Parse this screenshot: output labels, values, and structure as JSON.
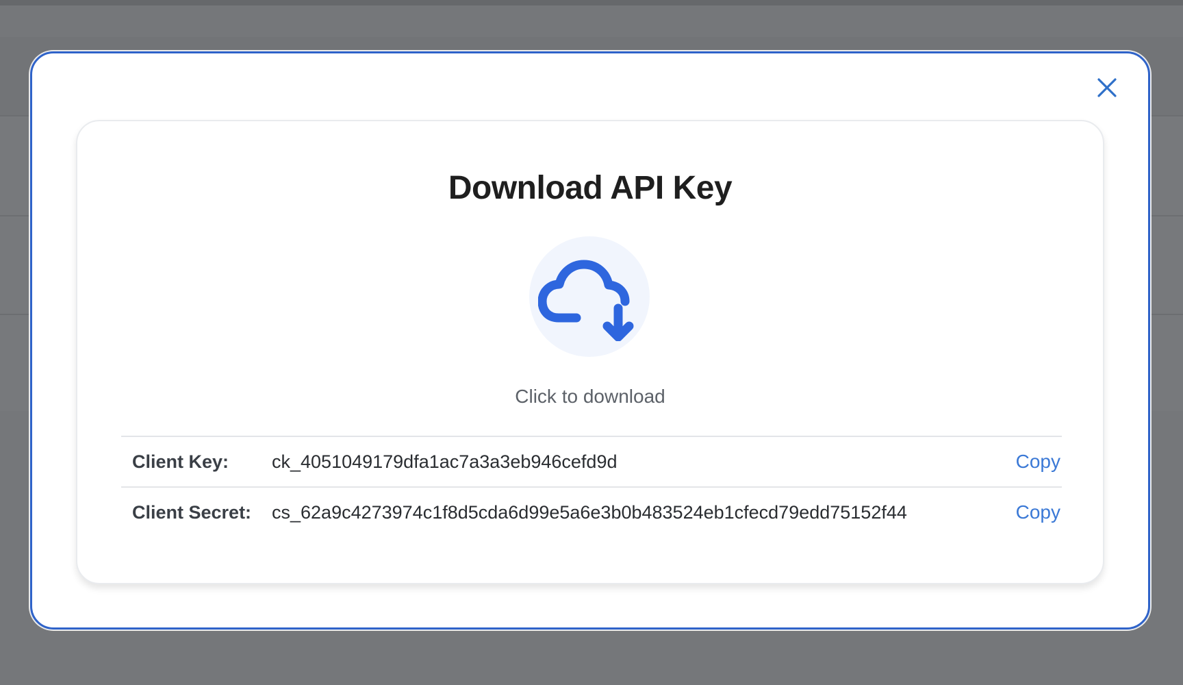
{
  "modal": {
    "title": "Download API Key",
    "download_hint": "Click to download",
    "icons": {
      "close": "close-icon",
      "download": "cloud-download-icon"
    },
    "colors": {
      "accent": "#2f63c9",
      "link": "#3b79d6",
      "icon_bg": "#f1f5fd"
    },
    "credentials": [
      {
        "label": "Client Key:",
        "value": "ck_4051049179dfa1ac7a3a3eb946cefd9d",
        "copy_label": "Copy"
      },
      {
        "label": "Client Secret:",
        "value": "cs_62a9c4273974c1f8d5cda6d99e5a6e3b0b483524eb1cfecd79edd75152f44",
        "copy_label": "Copy"
      }
    ]
  }
}
